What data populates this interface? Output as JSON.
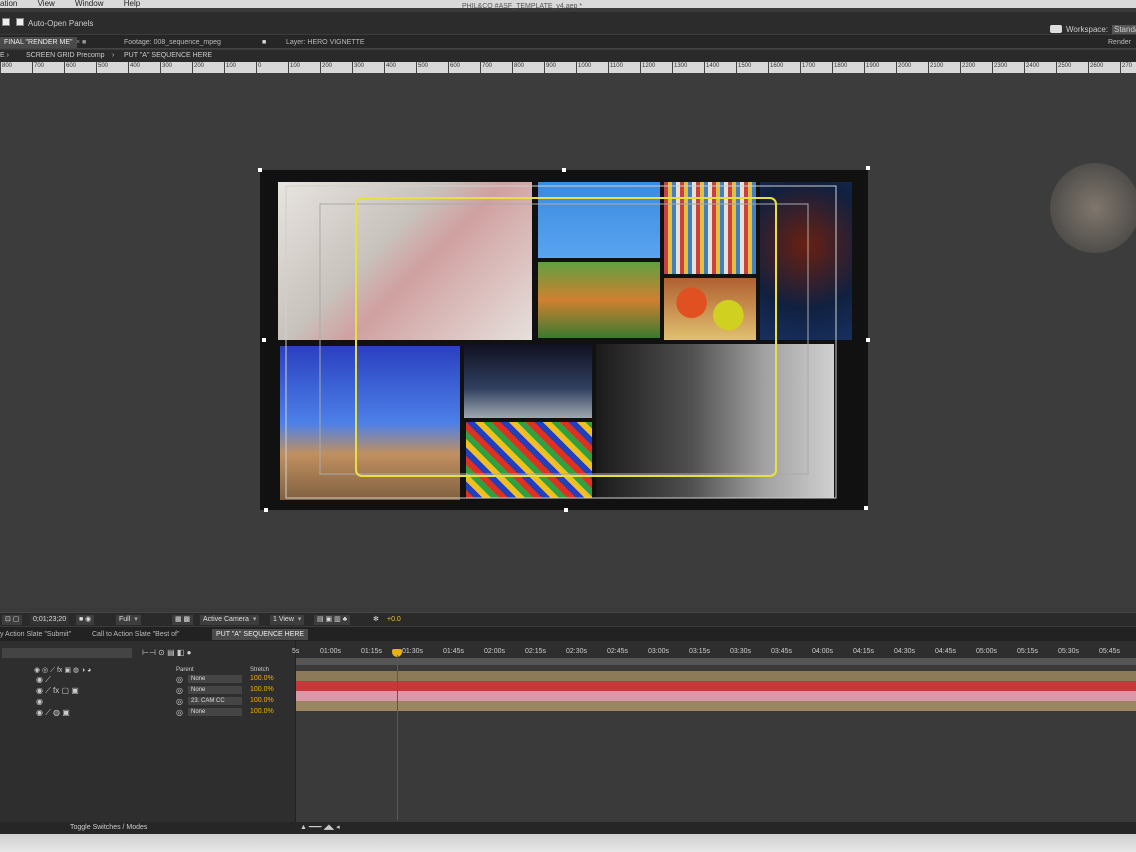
{
  "menubar": {
    "items": [
      "ation",
      "View",
      "Window",
      "Help"
    ],
    "doc_title": "PHIL&CO #ASF_TEMPLATE_v4.aep *"
  },
  "toolbar": {
    "auto_open_panels": "Auto-Open Panels",
    "workspace_label": "Workspace:",
    "workspace_value": "Standa",
    "render_label": "Render"
  },
  "panel_tabs": {
    "composition_tab": "FINAL \"RENDER ME\"",
    "footage_tab": "Footage: 008_sequence_mpeg",
    "layer_tab": "Layer: HERO VIGNETTE"
  },
  "breadcrumbs": [
    "SCREEN GRID Precomp",
    "PUT \"A\" SEQUENCE HERE"
  ],
  "ruler_ticks": [
    "800",
    "700",
    "600",
    "500",
    "400",
    "300",
    "200",
    "100",
    "0",
    "100",
    "200",
    "300",
    "400",
    "500",
    "600",
    "700",
    "800",
    "900",
    "1000",
    "1100",
    "1200",
    "1300",
    "1400",
    "1500",
    "1600",
    "1700",
    "1800",
    "1900",
    "2000",
    "2100",
    "2200",
    "2300",
    "2400",
    "2500",
    "2600",
    "270"
  ],
  "viewer_controls": {
    "timecode": "0;01;23;20",
    "resolution": "Full",
    "camera": "Active Camera",
    "views": "1 View",
    "exposure": "+0.0"
  },
  "timeline_tabs": [
    "y Action Slate \"Submit\"",
    "Call to Action Slate \"Best of\"",
    "PUT \"A\" SEQUENCE HERE"
  ],
  "timeline": {
    "time_labels": [
      "5s",
      "01:00s",
      "01:15s",
      "01:30s",
      "01:45s",
      "02:00s",
      "02:15s",
      "02:30s",
      "02:45s",
      "03:00s",
      "03:15s",
      "03:30s",
      "03:45s",
      "04:00s",
      "04:15s",
      "04:30s",
      "04:45s",
      "05:00s",
      "05:15s",
      "05:30s",
      "05:45s"
    ],
    "column_parent": "Parent",
    "column_stretch": "Stretch",
    "layers": [
      {
        "parent": "None",
        "stretch": "100.0%"
      },
      {
        "parent": "None",
        "stretch": "100.0%"
      },
      {
        "parent": "23. CAM CC",
        "stretch": "100.0%"
      },
      {
        "parent": "None",
        "stretch": "100.0%"
      }
    ],
    "toggle_label": "Toggle Switches / Modes"
  },
  "colors": {
    "bar_tan": "#8c7a58",
    "bar_red": "#c43a3a",
    "bar_pink": "#d89aa8",
    "bar_tan2": "#9a8660",
    "playhead": "#e02020",
    "stretch": "#f0b000",
    "guide_yellow": "#e8e040"
  }
}
